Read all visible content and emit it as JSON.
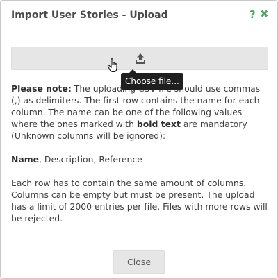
{
  "dialog": {
    "title": "Import User Stories - Upload",
    "help_icon": "?",
    "close_icon": "✖"
  },
  "upload": {
    "icon": "upload-icon",
    "tooltip": "Choose file..."
  },
  "note": {
    "lead": "Please note:",
    "p1_a": " The uploading CSV file should use commas (,) as delimiters. The first row contains the name for each column. The name can be one of the following values where the ones marked with ",
    "p1_bold": "bold text",
    "p1_b": " are mandatory (Unknown columns will be ignored):",
    "columns_bold": "Name",
    "columns_rest": ", Description, Reference",
    "p3": "Each row has to contain the same amount of columns. Columns can be empty but must be present. The upload has a limit of 2000 entries per file. Files with more rows will be rejected."
  },
  "footer": {
    "close_label": "Close"
  },
  "colors": {
    "accent": "#4aa55a",
    "tooltip_bg": "#1f1f1f",
    "button_bg": "#e6e6e6"
  }
}
